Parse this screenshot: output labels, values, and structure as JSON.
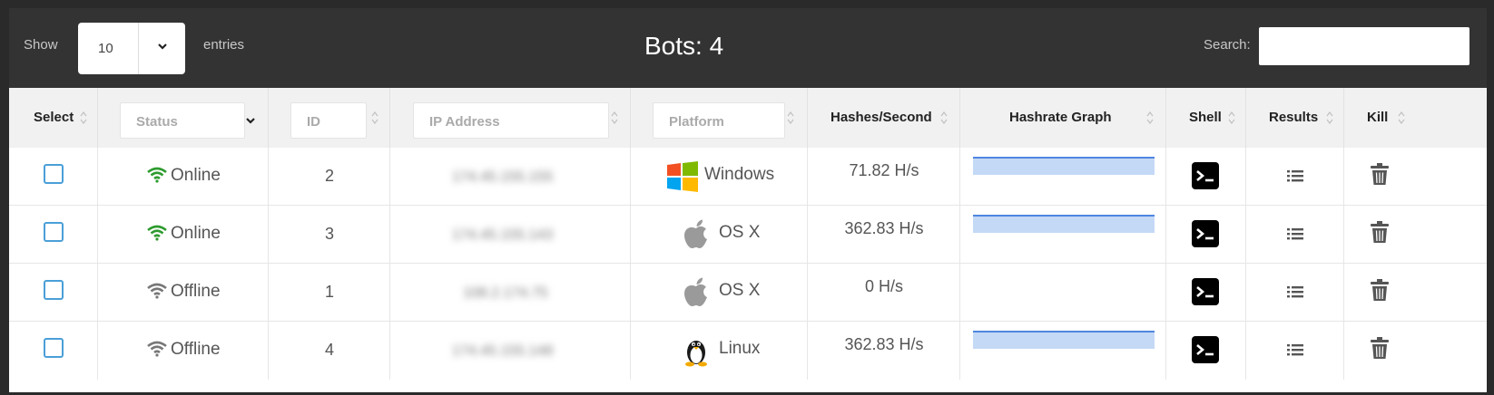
{
  "topbar": {
    "show_label": "Show",
    "entries_value": "10",
    "entries_label": "entries",
    "bots_title": "Bots: 4",
    "search_label": "Search:",
    "search_value": ""
  },
  "table": {
    "headers": {
      "select": "Select",
      "status": "Status",
      "id": "ID",
      "ip": "IP Address",
      "platform": "Platform",
      "hashes": "Hashes/Second",
      "graph": "Hashrate Graph",
      "shell": "Shell",
      "results": "Results",
      "kill": "Kill"
    },
    "rows": [
      {
        "status": "Online",
        "id": "2",
        "ip": "174.45.155.155",
        "platform": "Windows",
        "hashes": "71.82 H/s"
      },
      {
        "status": "Online",
        "id": "3",
        "ip": "174.45.155.143",
        "platform": "OS X",
        "hashes": "362.83 H/s"
      },
      {
        "status": "Offline",
        "id": "1",
        "ip": "108.2.174.75",
        "platform": "OS X",
        "hashes": "0 H/s"
      },
      {
        "status": "Offline",
        "id": "4",
        "ip": "174.45.155.148",
        "platform": "Linux",
        "hashes": "362.83 H/s"
      }
    ]
  },
  "colors": {
    "online": "#2e9b2e",
    "offline": "#777777",
    "checkbox": "#4a9fd8",
    "graph_fill": "#c4d9f6",
    "graph_line": "#4f86e0"
  }
}
